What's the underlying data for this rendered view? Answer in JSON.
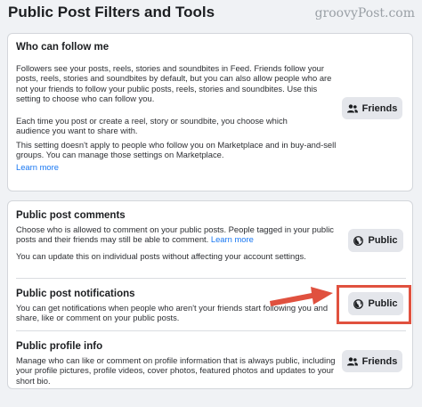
{
  "page": {
    "title": "Public Post Filters and Tools"
  },
  "watermark": "groovyPost.com",
  "follow": {
    "title": "Who can follow me",
    "line1": "Followers see your posts, reels, stories and soundbites in Feed. Friends follow your posts, reels, stories and soundbites by default, but you can also allow people who are not your friends to follow your public posts, reels, stories and soundbites. Use this setting to choose who can follow you.",
    "line2": "Each time you post or create a reel, story or soundbite, you choose which audience you want to share with.",
    "line3": "This setting doesn't apply to people who follow you on Marketplace and in buy-and-sell groups. You can manage those settings on Marketplace.",
    "learn_more": "Learn more",
    "button": "Friends"
  },
  "comments": {
    "title": "Public post comments",
    "desc": "Choose who is allowed to comment on your public posts. People tagged in your public posts and their friends may still be able to comment.",
    "learn_more": "Learn more",
    "note": "You can update this on individual posts without affecting your account settings.",
    "button": "Public"
  },
  "notifications": {
    "title": "Public post notifications",
    "desc": "You can get notifications when people who aren't your friends start following you and share, like or comment on your public posts.",
    "button": "Public"
  },
  "profile_info": {
    "title": "Public profile info",
    "desc": "Manage who can like or comment on profile information that is always public, including your profile pictures, profile videos, cover photos, featured photos and updates to your short bio.",
    "button": "Friends"
  },
  "colors": {
    "accent_link": "#1877f2",
    "annotation": "#e0513f"
  }
}
